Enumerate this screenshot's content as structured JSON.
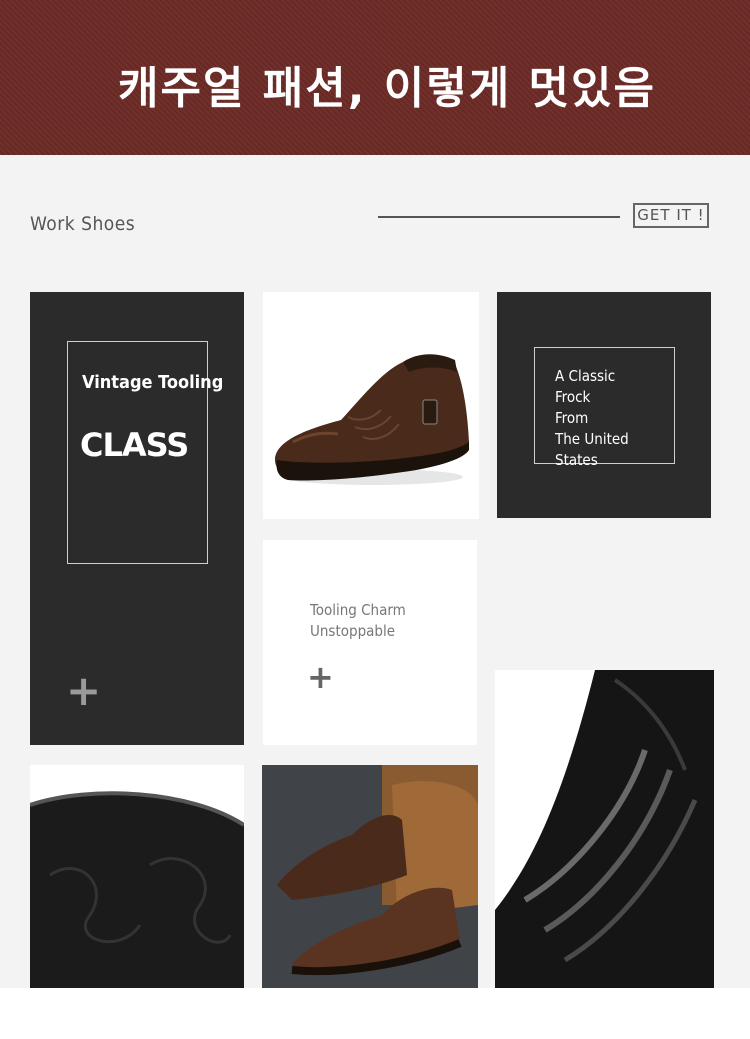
{
  "banner": {
    "title": "캐주얼 패션, 이렇게 멋있음",
    "background": "#6b2a26"
  },
  "header": {
    "section_label": "Work Shoes",
    "cta_label": "GET IT !"
  },
  "tiles": {
    "vintage": {
      "line1": "Vintage Tooling",
      "line2": "CLASS",
      "plus": "+"
    },
    "classic": {
      "lines": [
        "A Classic",
        "Frock",
        "From",
        "The United States"
      ]
    },
    "charm": {
      "lines": [
        "Tooling Charm",
        "Unstoppable"
      ],
      "plus": "+"
    }
  },
  "colors": {
    "dark_tile": "#2b2b2b",
    "page_bg": "#f3f3f3",
    "shoe_brown": "#4a2a1a"
  }
}
